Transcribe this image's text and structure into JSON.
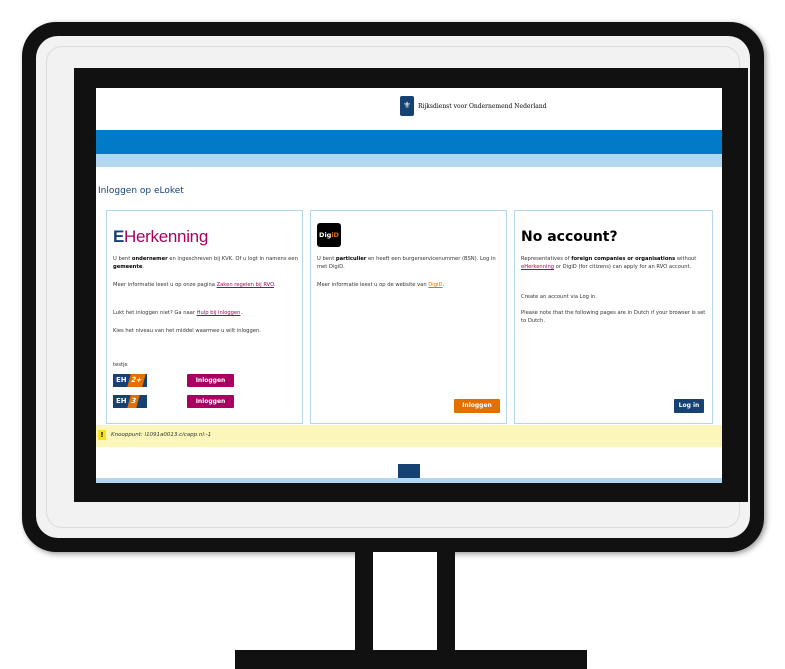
{
  "header": {
    "logo_text": "Rijksdienst voor Ondernemend Nederland",
    "logo_icon": "crest-icon"
  },
  "page": {
    "title": "Inloggen op eLoket"
  },
  "eherkenning": {
    "logo_e": "E",
    "logo_rest": "Herkenning",
    "p1_a": "U bent ",
    "p1_b": "ondernemer",
    "p1_c": " en ingeschreven bij KVK. Of u logt in namens een ",
    "p1_d": "gemeente",
    "p1_e": ".",
    "p2_a": "Meer informatie leest u op onze pagina ",
    "p2_link": "Zaken regelen bij RVO",
    "p2_b": ".",
    "p3_a": "Lukt het inloggen niet? Ga naar ",
    "p3_link": "Hulp bij inloggen",
    "p3_b": ".",
    "p4": "Kies het niveau van het middel waarmee u wilt inloggen.",
    "testje": "testje",
    "levels": [
      {
        "badge_prefix": "EH",
        "badge_level": "2+",
        "button": "Inloggen"
      },
      {
        "badge_prefix": "EH",
        "badge_level": "3",
        "button": "Inloggen"
      }
    ]
  },
  "digid": {
    "logo_a": "Dig",
    "logo_b": "iD",
    "p1_a": "U bent ",
    "p1_b": "particulier",
    "p1_c": " en heeft een burgerservicenummer (BSN). Log in met DigiD.",
    "p2_a": "Meer informatie leest u op de website van ",
    "p2_link": "DigiD",
    "p2_b": ".",
    "button": "Inloggen"
  },
  "no_account": {
    "title": "No account?",
    "p1_a": "Representatives of ",
    "p1_b": "foreign companies or organisations",
    "p1_c": " without ",
    "p1_link": "eHerkenning",
    "p1_d": " or DigiD (for citizens) can apply for an RVO account.",
    "p2": "Create an account via Log in.",
    "p3": "Please note that the following pages are in Dutch if your browser is set to Dutch.",
    "button": "Log in"
  },
  "notice": {
    "icon": "warning-icon",
    "text": "Knooppunt: l1091a0013.cicapp.nl:-1"
  },
  "colors": {
    "rvo_blue": "#154273",
    "bar_blue": "#007bc7",
    "eh_pink": "#a90061",
    "digid_orange": "#e17000"
  }
}
